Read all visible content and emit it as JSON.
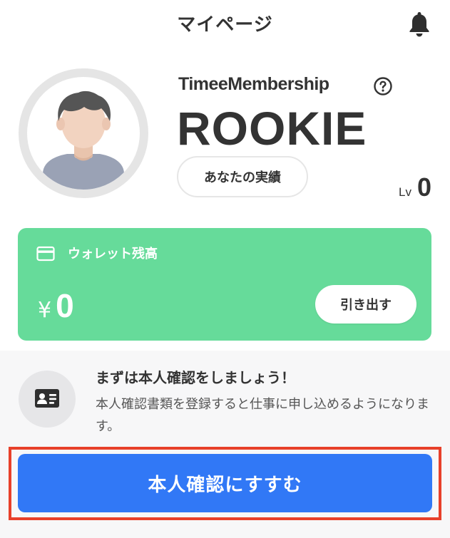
{
  "header": {
    "title": "マイページ",
    "notification_icon": "bell-icon"
  },
  "profile": {
    "avatar_icon": "user-avatar",
    "membership_label": "TimeeMembership",
    "help_icon": "question-circle-icon",
    "rank": "ROOKIE",
    "achievements_label": "あなたの実績",
    "level_prefix": "Lv",
    "level_value": "0"
  },
  "wallet": {
    "icon": "credit-card-icon",
    "label": "ウォレット残高",
    "currency_symbol": "¥",
    "balance": "0",
    "withdraw_label": "引き出す",
    "background_color": "#66db9a"
  },
  "identity_verification": {
    "icon": "id-card-icon",
    "title": "まずは本人確認をしましょう！",
    "description": "本人確認書類を登録すると仕事に申し込めるようになります。",
    "cta_label": "本人確認にすすむ",
    "cta_color": "#3178f6",
    "highlight_color": "#e8402a"
  }
}
